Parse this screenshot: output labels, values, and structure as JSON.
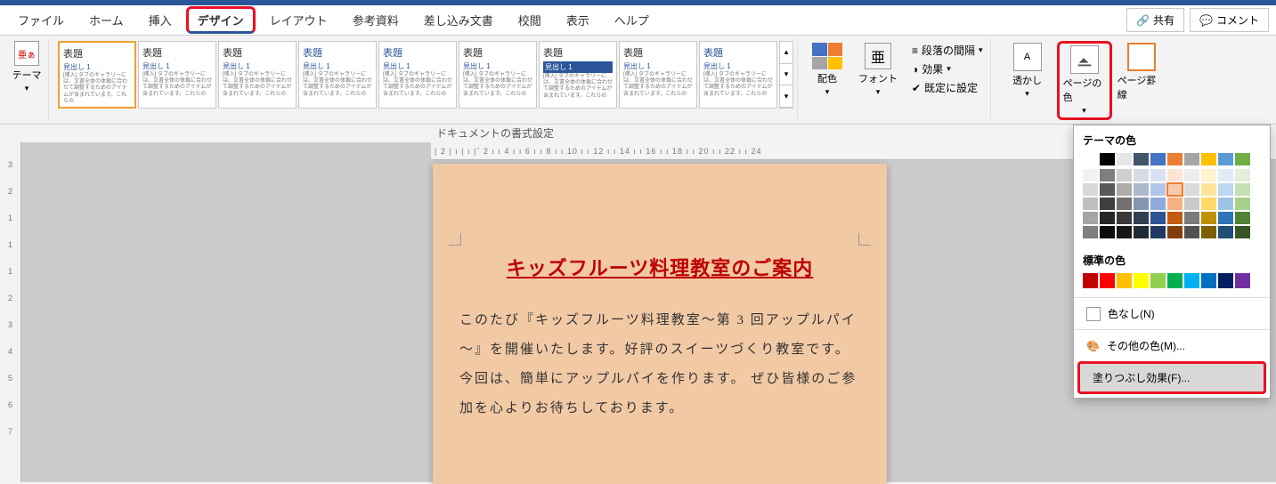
{
  "tabs": {
    "file": "ファイル",
    "home": "ホーム",
    "insert": "挿入",
    "design": "デザイン",
    "layout": "レイアウト",
    "references": "参考資料",
    "mail": "差し込み文書",
    "review": "校閲",
    "view": "表示",
    "help": "ヘルプ"
  },
  "share": {
    "share": "共有",
    "comment": "コメント"
  },
  "ribbon": {
    "themes": "テーマ",
    "gallery_title": "表題",
    "gallery_h1": "見出し 1",
    "gallery_body": "[挿入] タブのギャラリーには、文書全体の体裁に合わせて調整するためのアイテムが含まれています。これらの",
    "format_label": "ドキュメントの書式設定",
    "colors": "配色",
    "fonts": "フォント",
    "para_spacing": "段落の間隔",
    "effects": "効果",
    "set_default": "既定に設定",
    "watermark": "透かし",
    "page_color": "ページの色",
    "page_border": "ページ罫線"
  },
  "ruler_h": "| 2 |  ı  |  ı  |ˇ 2 ı   ı 4 ı   ı 6 ı   ı 8 ı   ı 10 ı   ı 12 ı   ı 14 ı   ı 16 ı   ı 18 ı   ı 20 ı   ı 22 ı   ı 24",
  "ruler_v": [
    "3",
    "2",
    "1",
    "1",
    "1",
    "2",
    "3",
    "4",
    "5",
    "6",
    "7"
  ],
  "document": {
    "title": "キッズフルーツ料理教室のご案内",
    "body": "このたび『キッズフルーツ料理教室～第 3 回アップルパイ～』を開催いたします。好評のスイーツづくり教室です。今回は、簡単にアップルパイを作ります。 ぜひ皆様のご参加を心よりお待ちしております。"
  },
  "dropdown": {
    "theme_colors_label": "テーマの色",
    "standard_colors_label": "標準の色",
    "no_color": "色なし(N)",
    "more_colors": "その他の色(M)...",
    "fill_effects": "塗りつぶし効果(F)...",
    "theme_row": [
      "#ffffff",
      "#000000",
      "#e7e6e6",
      "#44546a",
      "#4472c4",
      "#ed7d31",
      "#a5a5a5",
      "#ffc000",
      "#5b9bd5",
      "#70ad47"
    ],
    "shades": [
      "#f2f2f2",
      "#7f7f7f",
      "#d0cece",
      "#d6dce4",
      "#d9e2f3",
      "#fbe5d5",
      "#ededed",
      "#fff2cc",
      "#deebf6",
      "#e2efd9",
      "#d8d8d8",
      "#595959",
      "#aeabab",
      "#adb9ca",
      "#b4c6e7",
      "#f7cbac",
      "#dbdbdb",
      "#fee599",
      "#bdd7ee",
      "#c5e0b3",
      "#bfbfbf",
      "#3f3f3f",
      "#757070",
      "#8496b0",
      "#8eaadb",
      "#f4b183",
      "#c9c9c9",
      "#ffd965",
      "#9cc3e5",
      "#a8d08d",
      "#a5a5a5",
      "#262626",
      "#3a3838",
      "#323f4f",
      "#2f5496",
      "#c55a11",
      "#7b7b7b",
      "#bf9000",
      "#2e75b5",
      "#538135",
      "#7f7f7f",
      "#0c0c0c",
      "#171616",
      "#222a35",
      "#1f3864",
      "#833c0b",
      "#525252",
      "#7f6000",
      "#1e4e79",
      "#375623"
    ],
    "selected_shade_index": 15,
    "standard": [
      "#c00000",
      "#ff0000",
      "#ffc000",
      "#ffff00",
      "#92d050",
      "#00b050",
      "#00b0f0",
      "#0070c0",
      "#002060",
      "#7030a0"
    ]
  }
}
